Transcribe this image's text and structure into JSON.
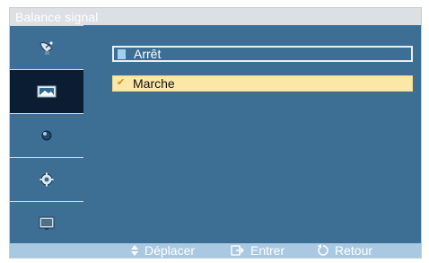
{
  "title": "Balance signal",
  "sidebar": {
    "items": [
      {
        "icon": "satellite-dish-icon",
        "active": false
      },
      {
        "icon": "picture-icon",
        "active": true
      },
      {
        "icon": "sound-icon",
        "active": false
      },
      {
        "icon": "settings-gear-icon",
        "active": false
      },
      {
        "icon": "display-screen-icon",
        "active": false
      }
    ]
  },
  "options": [
    {
      "label": "Arrêt",
      "selected": false,
      "highlighted": true
    },
    {
      "label": "Marche",
      "selected": true,
      "highlighted": false
    }
  ],
  "hints": {
    "move": {
      "icon": "up-down-arrows-icon",
      "label": "Déplacer"
    },
    "enter": {
      "icon": "enter-icon",
      "label": "Entrer"
    },
    "back": {
      "icon": "return-icon",
      "label": "Retour"
    }
  },
  "colors": {
    "panel": "#3d6f95",
    "active_sidebar": "#0a1d33",
    "selected_option": "#fbe7a8",
    "bottom_bar": "#a9c9e2"
  }
}
